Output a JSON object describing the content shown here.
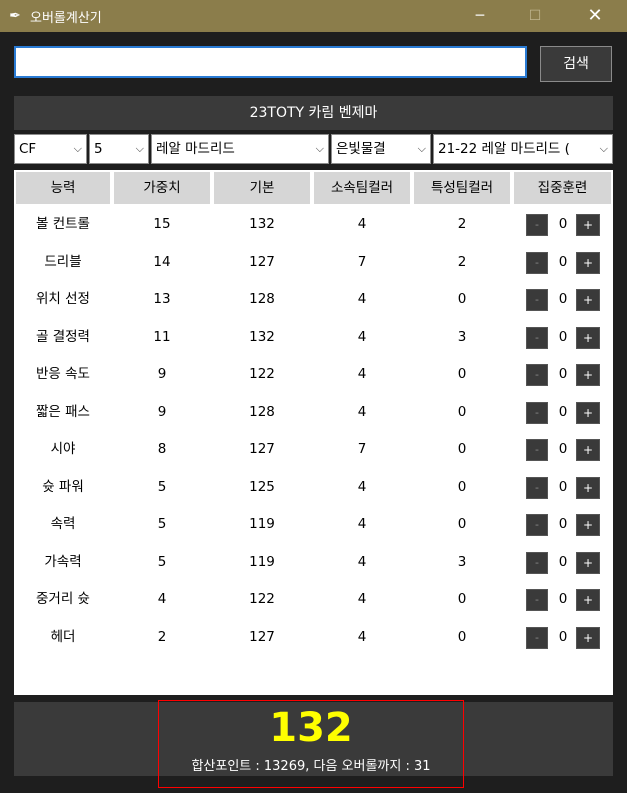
{
  "window": {
    "title": "오버롤계산기"
  },
  "search": {
    "value": "",
    "button_label": "검색"
  },
  "player": {
    "name": "23TOTY 카림 벤제마"
  },
  "selectors": {
    "position": "CF",
    "grade": "5",
    "team": "레알 마드리드",
    "mark": "은빛물결",
    "team_color": "21-22 레알 마드리드 ("
  },
  "table": {
    "headers": [
      "능력",
      "가중치",
      "기본",
      "소속팀컬러",
      "특성팀컬러",
      "집중훈련"
    ],
    "rows": [
      {
        "stat": "볼 컨트롤",
        "weight": "15",
        "base": "132",
        "team_color": "4",
        "trait_color": "2",
        "training": "0"
      },
      {
        "stat": "드리블",
        "weight": "14",
        "base": "127",
        "team_color": "7",
        "trait_color": "2",
        "training": "0"
      },
      {
        "stat": "위치 선정",
        "weight": "13",
        "base": "128",
        "team_color": "4",
        "trait_color": "0",
        "training": "0"
      },
      {
        "stat": "골 결정력",
        "weight": "11",
        "base": "132",
        "team_color": "4",
        "trait_color": "3",
        "training": "0"
      },
      {
        "stat": "반응 속도",
        "weight": "9",
        "base": "122",
        "team_color": "4",
        "trait_color": "0",
        "training": "0"
      },
      {
        "stat": "짧은 패스",
        "weight": "9",
        "base": "128",
        "team_color": "4",
        "trait_color": "0",
        "training": "0"
      },
      {
        "stat": "시야",
        "weight": "8",
        "base": "127",
        "team_color": "7",
        "trait_color": "0",
        "training": "0"
      },
      {
        "stat": "슛 파워",
        "weight": "5",
        "base": "125",
        "team_color": "4",
        "trait_color": "0",
        "training": "0"
      },
      {
        "stat": "속력",
        "weight": "5",
        "base": "119",
        "team_color": "4",
        "trait_color": "0",
        "training": "0"
      },
      {
        "stat": "가속력",
        "weight": "5",
        "base": "119",
        "team_color": "4",
        "trait_color": "3",
        "training": "0"
      },
      {
        "stat": "중거리 슛",
        "weight": "4",
        "base": "122",
        "team_color": "4",
        "trait_color": "0",
        "training": "0"
      },
      {
        "stat": "헤더",
        "weight": "2",
        "base": "127",
        "team_color": "4",
        "trait_color": "0",
        "training": "0"
      }
    ],
    "minus_label": "-",
    "plus_label": "+"
  },
  "result": {
    "overall": "132",
    "summary": "합산포인트 : 13269, 다음 오버롤까지 : 31"
  },
  "colors": {
    "titlebar": "#8b7d4b",
    "overall": "#ffff00",
    "highlight_border": "#ff0000",
    "input_border": "#2a7bd4"
  },
  "icons": {
    "app": "feather-icon",
    "minimize": "minimize-icon",
    "maximize": "maximize-icon",
    "close": "close-icon",
    "dropdown": "chevron-down-icon"
  }
}
